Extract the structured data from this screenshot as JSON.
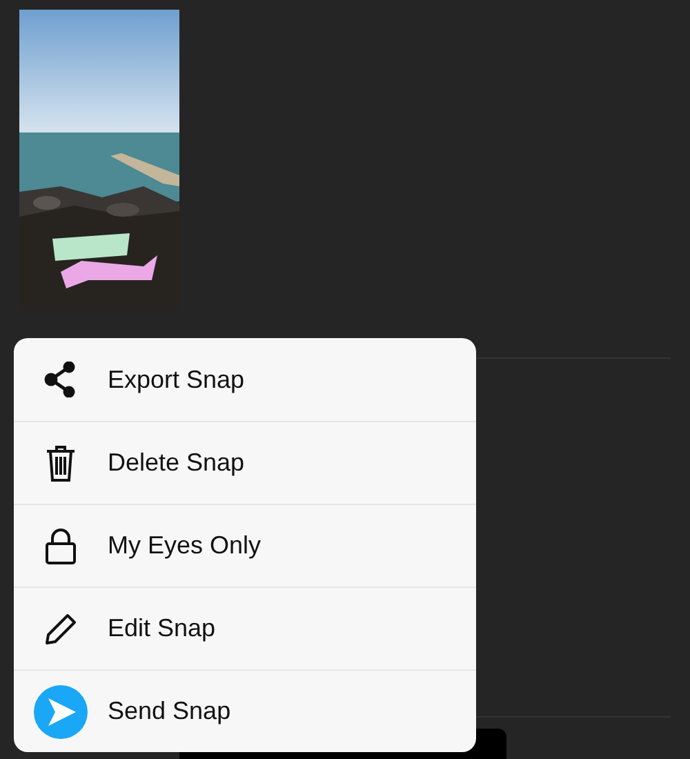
{
  "menu": {
    "items": [
      {
        "label": "Export Snap"
      },
      {
        "label": "Delete Snap"
      },
      {
        "label": "My Eyes Only"
      },
      {
        "label": "Edit Snap"
      },
      {
        "label": "Send Snap"
      }
    ]
  }
}
